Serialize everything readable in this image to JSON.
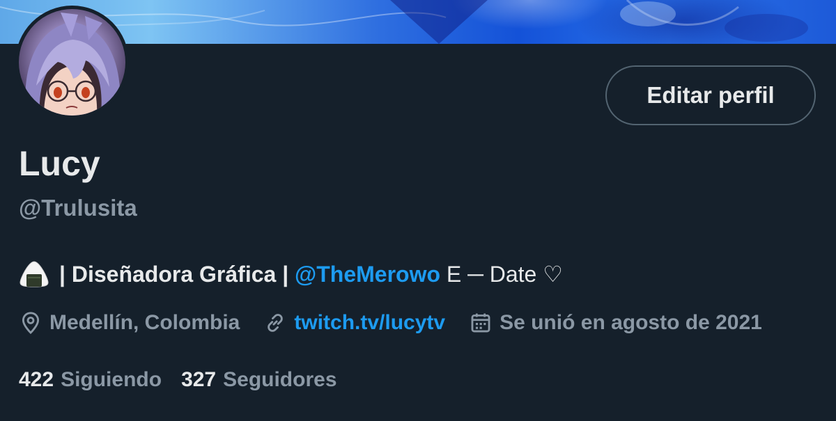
{
  "colors": {
    "background": "#15202b",
    "text_primary": "#e7e9ea",
    "text_secondary": "#8b98a5",
    "accent": "#1d9bf0",
    "button_border": "#536471"
  },
  "banner": {
    "icon": "banner-image"
  },
  "avatar": {
    "icon": "avatar-image"
  },
  "edit_button": {
    "label": "Editar perfil"
  },
  "profile": {
    "name": "Lucy",
    "handle": "@Trulusita"
  },
  "bio": {
    "emoji_icon": "onigiri-emoji",
    "part1": "| Diseñadora Gráfica |",
    "mention": "@TheMerowo",
    "part2": "E ─ Date ♡"
  },
  "meta": {
    "location": {
      "icon": "location-pin-icon",
      "text": "Medellín, Colombia"
    },
    "website": {
      "icon": "link-icon",
      "text": "twitch.tv/lucytv"
    },
    "joined": {
      "icon": "calendar-icon",
      "text": "Se unió en agosto de 2021"
    }
  },
  "stats": {
    "following": {
      "count": "422",
      "label": "Siguiendo"
    },
    "followers": {
      "count": "327",
      "label": "Seguidores"
    }
  }
}
